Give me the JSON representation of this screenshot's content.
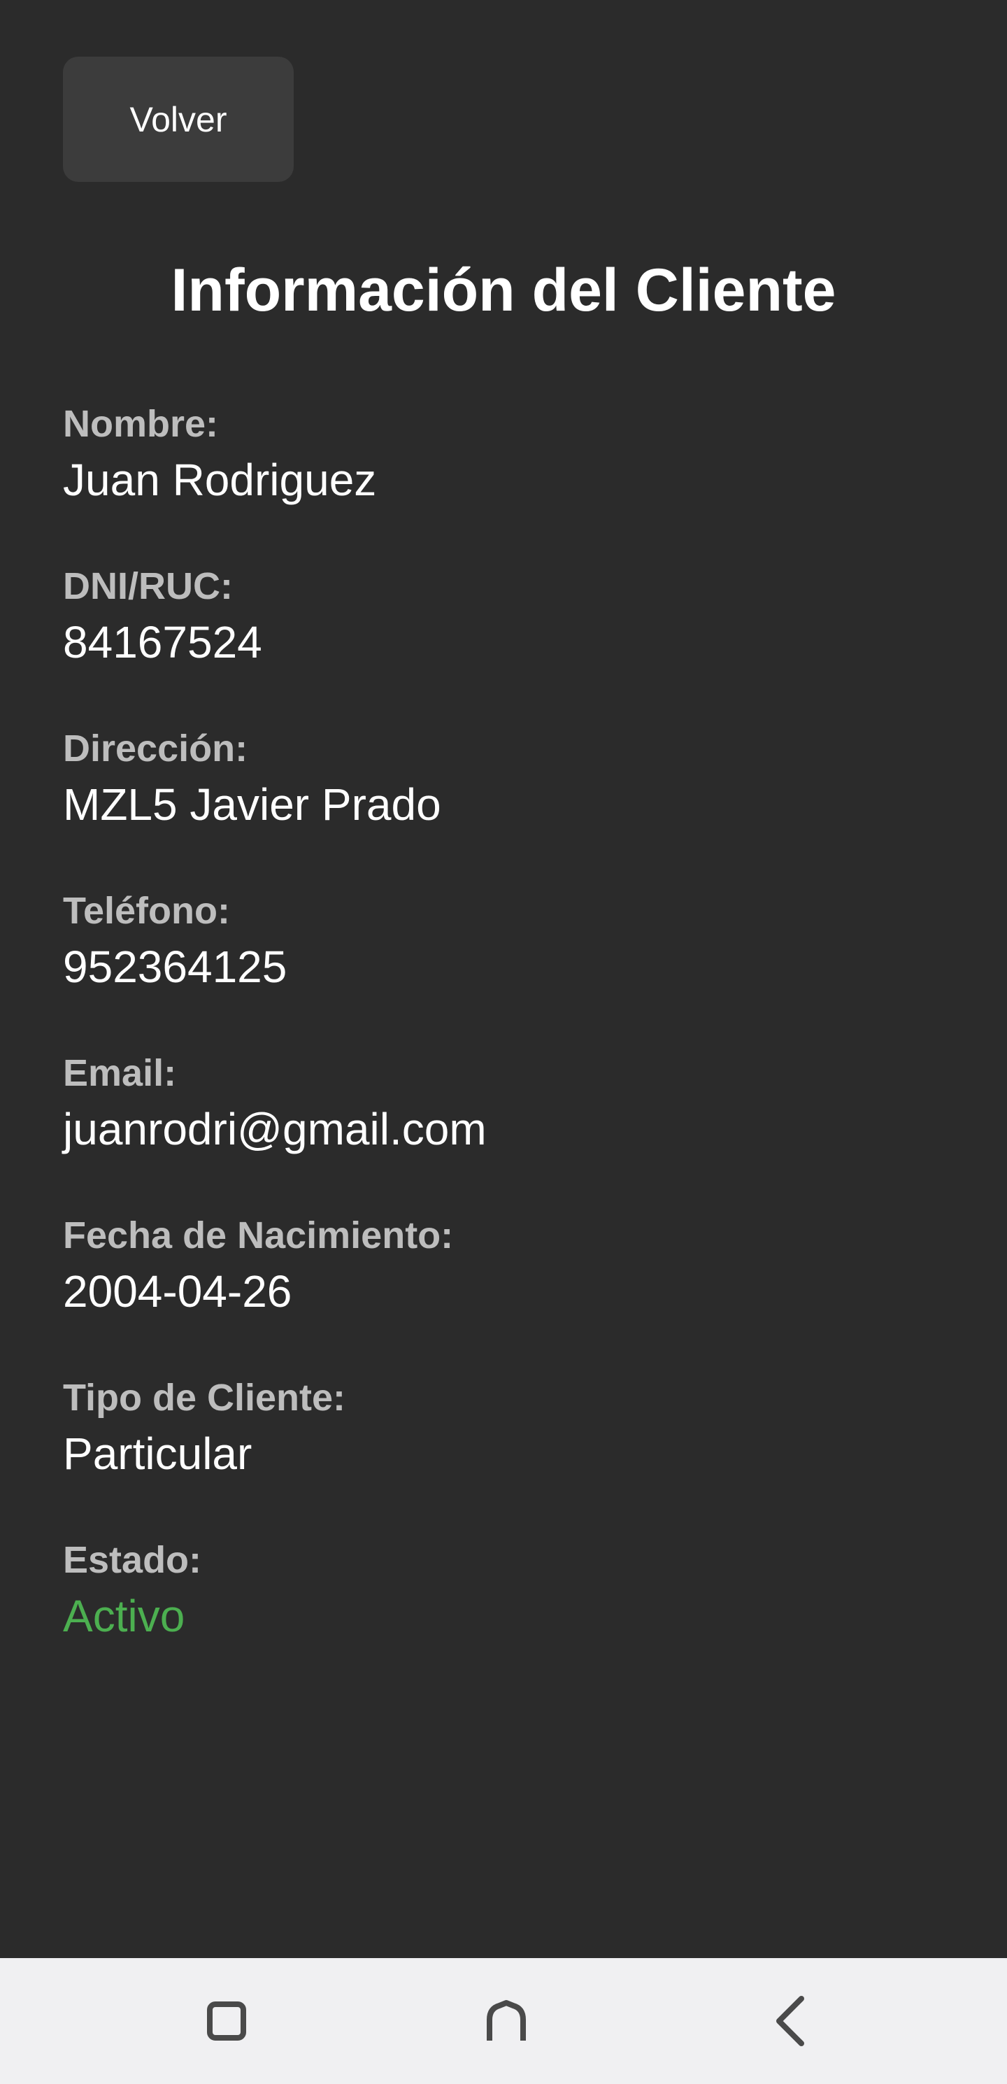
{
  "header": {
    "back_label": "Volver",
    "title": "Información del Cliente"
  },
  "client": {
    "fields": [
      {
        "label": "Nombre:",
        "value": "Juan Rodriguez"
      },
      {
        "label": "DNI/RUC:",
        "value": "84167524"
      },
      {
        "label": "Dirección:",
        "value": "MZL5 Javier Prado"
      },
      {
        "label": "Teléfono:",
        "value": "952364125"
      },
      {
        "label": "Email:",
        "value": "juanrodri@gmail.com"
      },
      {
        "label": "Fecha de Nacimiento:",
        "value": "2004-04-26"
      },
      {
        "label": "Tipo de Cliente:",
        "value": "Particular"
      },
      {
        "label": "Estado:",
        "value": "Activo"
      }
    ]
  },
  "colors": {
    "background": "#2b2b2b",
    "button": "#3c3c3c",
    "label": "#bdbdbd",
    "status_active": "#4caf50",
    "navbar": "#f0f0f2"
  },
  "navbar": {
    "icons": [
      "recents-icon",
      "home-icon",
      "back-arrow-icon"
    ]
  }
}
